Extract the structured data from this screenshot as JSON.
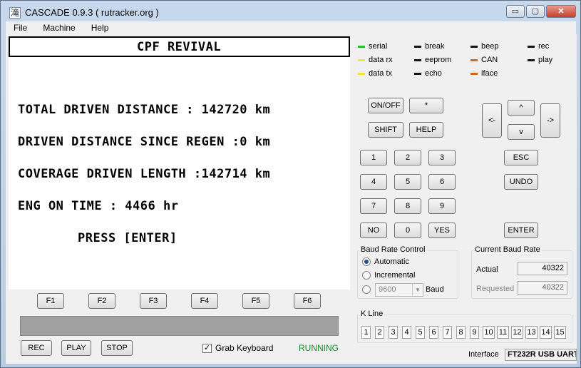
{
  "window": {
    "title": "CASCADE 0.9.3 ( rutracker.org )",
    "icon_glyph": "滝",
    "min": "▭",
    "max": "▢",
    "close": "✕"
  },
  "menu": [
    "File",
    "Machine",
    "Help"
  ],
  "lcd": {
    "title": "CPF REVIVAL",
    "lines": [
      "TOTAL DRIVEN DISTANCE : 142720 km",
      "DRIVEN DISTANCE SINCE REGEN :0 km",
      "COVERAGE DRIVEN LENGTH :142714 km",
      "ENG ON TIME : 4466 hr",
      "PRESS [ENTER]"
    ]
  },
  "function_keys": [
    "F1",
    "F2",
    "F3",
    "F4",
    "F5",
    "F6"
  ],
  "transport": {
    "rec": "REC",
    "play": "PLAY",
    "stop": "STOP"
  },
  "grab_keyboard": {
    "label": "Grab Keyboard",
    "checked": true,
    "mark": "✓"
  },
  "status": "RUNNING",
  "indicators": [
    {
      "label": "serial",
      "color": "#22c02a"
    },
    {
      "label": "data rx",
      "color": "#f2e632"
    },
    {
      "label": "data tx",
      "color": "#f2e632"
    },
    {
      "label": "break",
      "color": "#111111"
    },
    {
      "label": "eeprom",
      "color": "#111111"
    },
    {
      "label": "echo",
      "color": "#111111"
    },
    {
      "label": "beep",
      "color": "#111111"
    },
    {
      "label": "CAN",
      "color": "#d26a1e"
    },
    {
      "label": "iface",
      "color": "#d26a1e"
    },
    {
      "label": "rec",
      "color": "#111111"
    },
    {
      "label": "play",
      "color": "#111111"
    }
  ],
  "keypad": {
    "onoff": "ON/OFF",
    "star": "*",
    "shift": "SHIFT",
    "help": "HELP",
    "up": "^",
    "down": "v",
    "left": "<-",
    "right": "->",
    "digits": [
      "1",
      "2",
      "3",
      "4",
      "5",
      "6",
      "7",
      "8",
      "9"
    ],
    "no": "NO",
    "zero": "0",
    "yes": "YES",
    "esc": "ESC",
    "undo": "UNDO",
    "enter": "ENTER"
  },
  "baud_control": {
    "title": "Baud Rate Control",
    "automatic": "Automatic",
    "incremental": "Incremental",
    "selected": "automatic",
    "manual_value": "9600",
    "unit": "Baud",
    "dropdown_glyph": "▼"
  },
  "current_baud": {
    "title": "Current Baud Rate",
    "actual_label": "Actual",
    "actual_value": "40322",
    "requested_label": "Requested",
    "requested_value": "40322"
  },
  "k_line": {
    "title": "K Line",
    "pins": [
      "1",
      "2",
      "3",
      "4",
      "5",
      "6",
      "7",
      "8",
      "9",
      "10",
      "11",
      "12",
      "13",
      "14",
      "15"
    ]
  },
  "interface": {
    "label": "Interface",
    "value": "FT232R USB UART"
  }
}
